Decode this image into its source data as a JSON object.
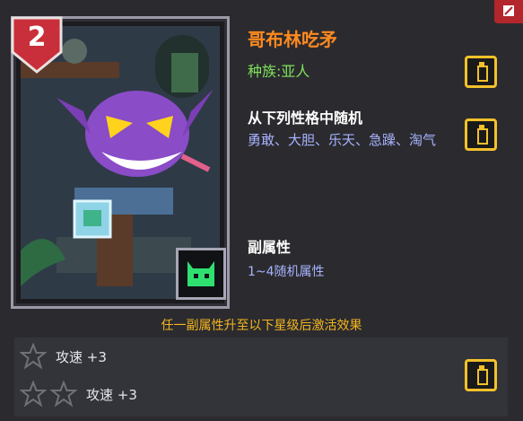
{
  "character": {
    "name": "哥布林吃矛",
    "race": "种族:亚人",
    "level": "2"
  },
  "traits": {
    "title": "从下列性格中随机",
    "list": "勇敢、大胆、乐天、急躁、淘气"
  },
  "sub_attributes": {
    "title": "副属性",
    "desc": "1~4随机属性"
  },
  "activation_note": "任一副属性升至以下星级后激活效果",
  "star_effects": [
    {
      "stars": 1,
      "label": "攻速 +3"
    },
    {
      "stars": 2,
      "label": "攻速 +3"
    }
  ],
  "colors": {
    "name": "#ff8a1f",
    "race": "#7fe35a",
    "accent_yellow": "#f2c12b",
    "level_badge": "#c92f3a",
    "element_green": "#2fe071"
  },
  "icons": {
    "copy": "clipboard-icon",
    "star": "star-outline-icon",
    "element": "slime-face-icon",
    "close": "edit-icon"
  }
}
